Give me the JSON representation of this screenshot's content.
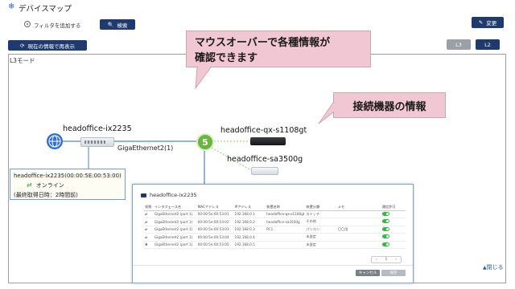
{
  "header": {
    "icon": "snowflake-icon",
    "title": "デバイスマップ"
  },
  "filter": {
    "label": "フィルタを追加する"
  },
  "toolbar": {
    "search_label": "検索",
    "edit_label": "変更",
    "refresh_label": "現在の情報で再表示",
    "l3_label": "L3",
    "l2_label": "L2"
  },
  "map": {
    "mode_label": "L3モード",
    "nodes": {
      "left_name": "headoffice-ix2235",
      "right_top_name": "headoffice-qx-s1108gt",
      "right_bottom_name": "headoffice-sa3500g"
    },
    "link_label": "GigaEthernet2(1)",
    "badge_count": "5"
  },
  "info_box": {
    "line1": "headoffice-ix2235(00:00:5E:00:53:00)",
    "status": "オンライン",
    "line3": "(最終取得日時：2時間前)"
  },
  "callouts": {
    "top": [
      "マウスオーバーで各種情報が",
      "確認できます"
    ],
    "right": "接続機器の情報"
  },
  "popup": {
    "title": "headoffice-ix2235",
    "columns": [
      "状態",
      "インタフェース名",
      "MACアドレス",
      "IPアドレス",
      "装置名称",
      "装置分類",
      "メモ",
      "通信許可"
    ],
    "rows": [
      {
        "status": "ok",
        "iface": "GigaEthernet2 (port 1)",
        "mac": "00:00:5e:00:53:01",
        "ip": "192.168.0.1",
        "device": "headoffice-qx-s1108gt",
        "category": "スイッチ",
        "memo": ""
      },
      {
        "status": "ok",
        "iface": "GigaEthernet2 (port 1)",
        "mac": "00:00:5e:00:53:02",
        "ip": "192.168.0.2",
        "device": "headoffice-sa3500g",
        "category": "その他",
        "memo": ""
      },
      {
        "status": "ok",
        "iface": "GigaEthernet2 (port 1)",
        "mac": "00:00:5e:00:53:03",
        "ip": "192.168.0.3",
        "device": "PC1",
        "category": "パソコン",
        "memo": "〇〇用"
      },
      {
        "status": "ok",
        "iface": "GigaEthernet2 (port 1)",
        "mac": "00:00:5e:00:53:04",
        "ip": "192.168.0.4",
        "device": "",
        "category": "未設定",
        "memo": ""
      },
      {
        "status": "ng",
        "iface": "GigaEthernet2 (port 1)",
        "mac": "00:00:5e:00:53:05",
        "ip": "192.168.0.5",
        "device": "",
        "category": "未設定",
        "memo": ""
      }
    ],
    "pager": [
      "‹",
      "1",
      "›"
    ],
    "cancel_label": "キャンセル",
    "save_label": "保存"
  },
  "footer": {
    "close_label": "閉じる"
  },
  "colors": {
    "navy": "#1f3b6e",
    "callout": "#f2c7d4",
    "badge": "#6db33f",
    "globe": "#2f6fd6"
  }
}
